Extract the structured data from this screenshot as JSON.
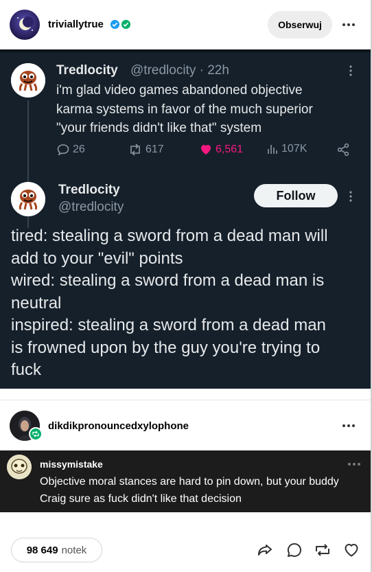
{
  "post": {
    "blog_name": "triviallytrue",
    "follow_label": "Obserwuj"
  },
  "tweet": {
    "first": {
      "name": "Tredlocity",
      "handle_time": "@tredlocity · 22h",
      "text_lines": [
        "i'm glad video games abandoned objective",
        "karma systems in favor of the much superior",
        "\"your friends didn't like that\" system"
      ],
      "replies": "26",
      "retweets": "617",
      "likes": "6,561",
      "views": "107K"
    },
    "second": {
      "name": "Tredlocity",
      "handle": "@tredlocity",
      "follow_label": "Follow",
      "text_lines": [
        "tired: stealing a sword from a dead man will",
        "add to your \"evil\" points",
        "wired: stealing a sword from a dead man is",
        "neutral",
        "inspired: stealing a sword from a dead man",
        "is frowned upon by the guy you're trying to",
        "fuck"
      ]
    }
  },
  "reblog": {
    "name": "dikdikpronouncedxylophone"
  },
  "comment": {
    "name": "missymistake",
    "text": "Objective moral stances are hard to pin down, but your buddy Craig sure as fuck didn't like that decision"
  },
  "footer": {
    "notes_count": "98 649",
    "notes_label": "notek"
  },
  "colors": {
    "tweet_bg": "#15202b",
    "like_pink": "#f91880",
    "reblog_green": "#00b06b",
    "comment_bg": "#1c1c1c"
  }
}
